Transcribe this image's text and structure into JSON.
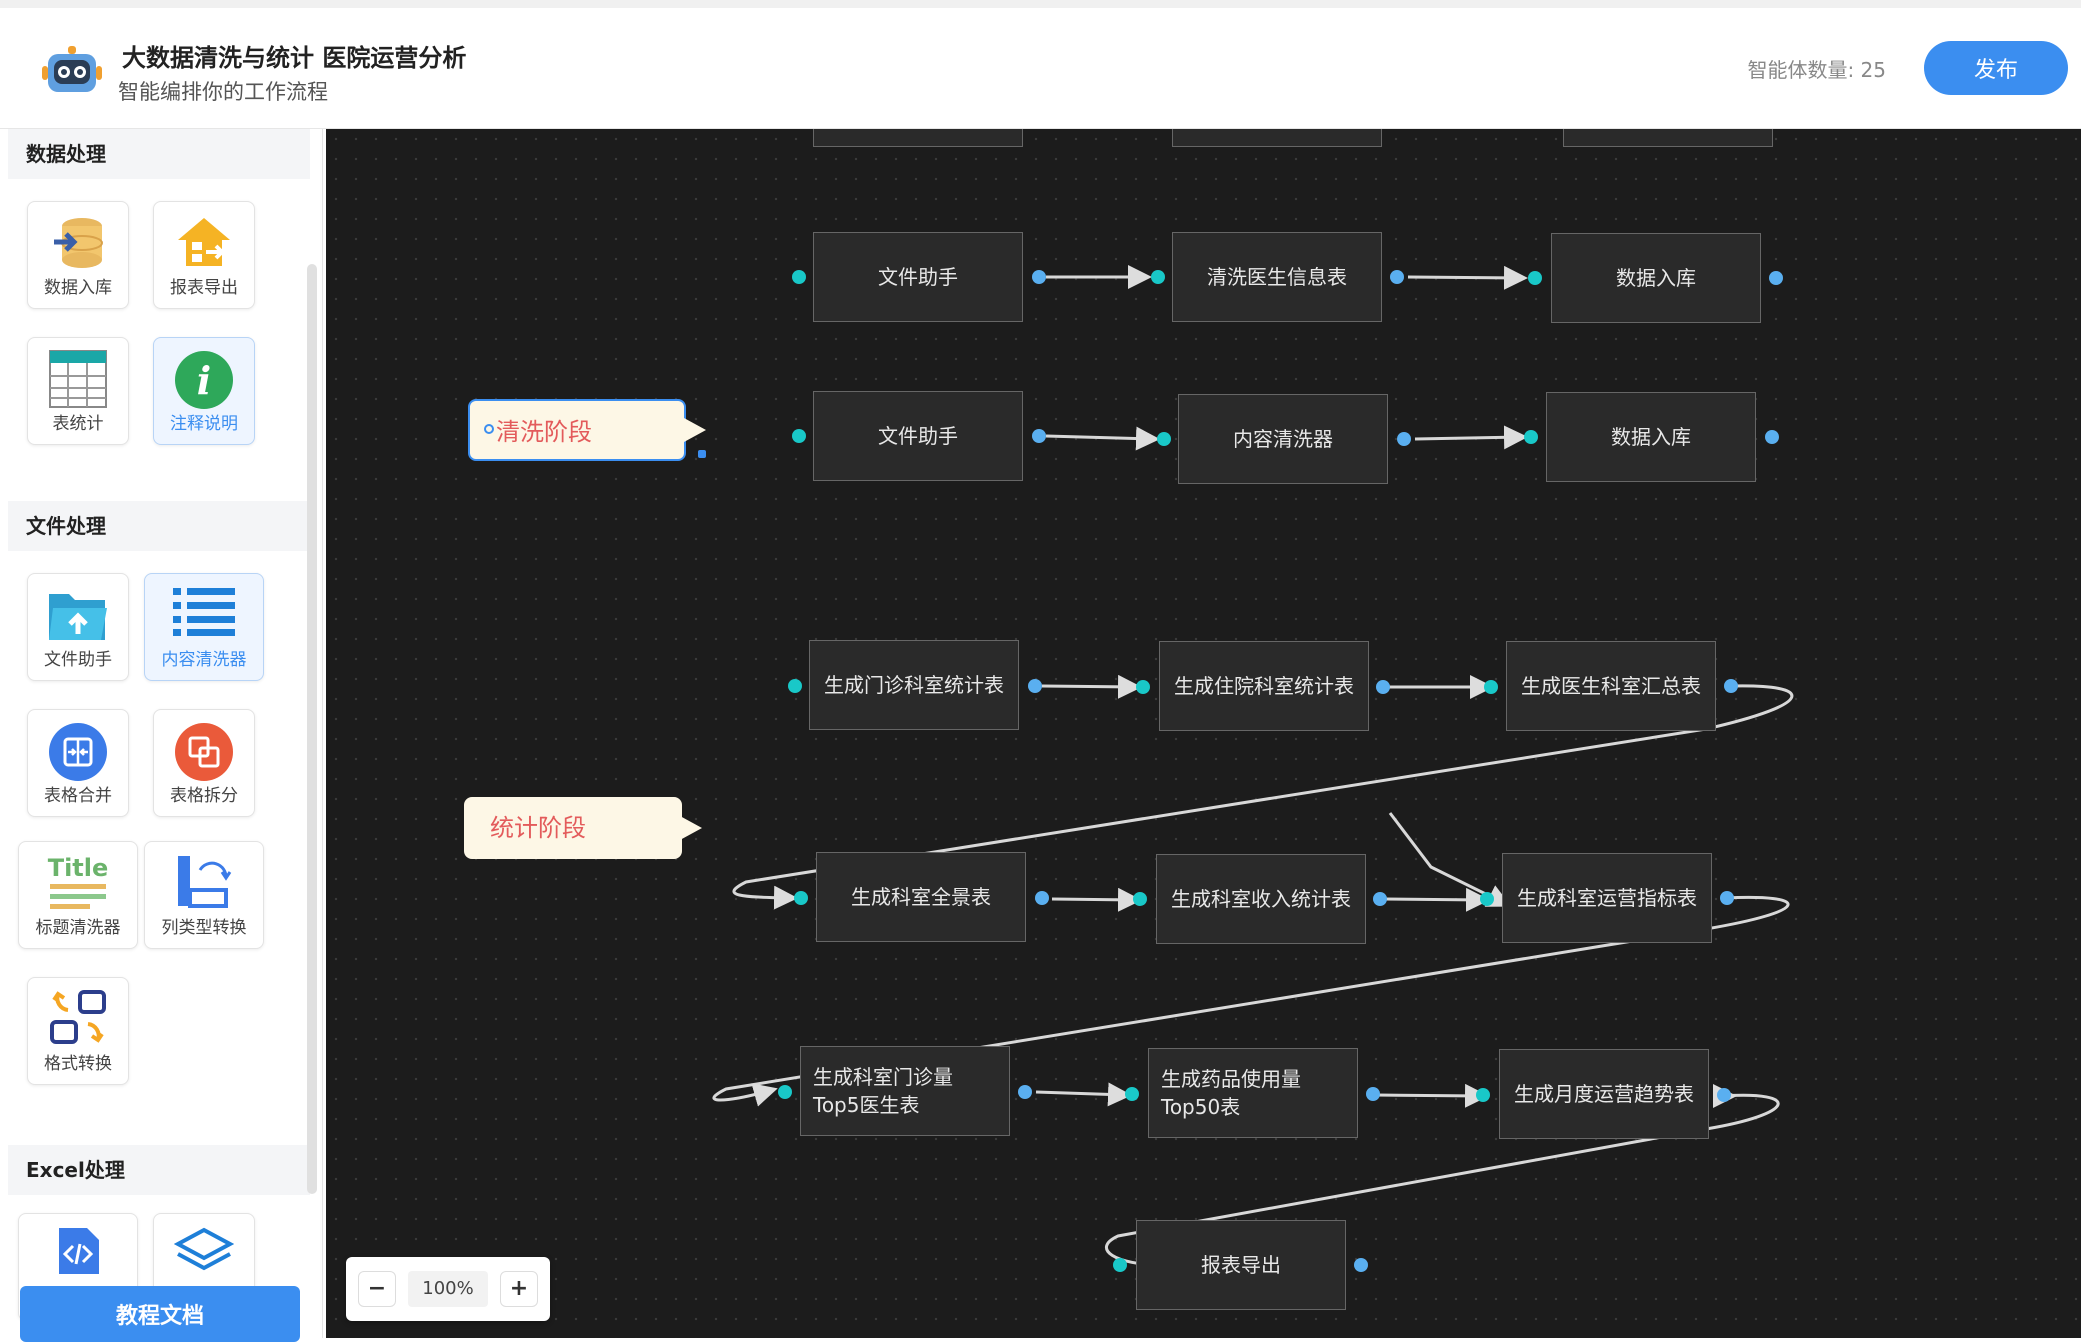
{
  "header": {
    "title": "大数据清洗与统计  医院运营分析",
    "subtitle": "智能编排你的工作流程",
    "agent_count": "智能体数量: 25",
    "publish_label": "发布"
  },
  "sidebar": {
    "sections": {
      "data": "数据处理",
      "file": "文件处理",
      "excel": "Excel处理"
    },
    "tools": {
      "data_import": "数据入库",
      "report_export": "报表导出",
      "table_stats": "表统计",
      "annotation": "注释说明",
      "file_helper": "文件助手",
      "content_cleaner": "内容清洗器",
      "table_merge": "表格合并",
      "table_split": "表格拆分",
      "title_cleaner": "标题清洗器",
      "column_type": "列类型转换",
      "format_convert": "格式转换"
    },
    "icon_text": {
      "title_cleaner": "Title"
    },
    "docs_label": "教程文档"
  },
  "canvas": {
    "notes": {
      "cleaning": "清洗阶段",
      "stats": "统计阶段"
    },
    "nodes": {
      "r1a": "文件助手",
      "r1b": "清洗医生信息表",
      "r1c": "数据入库",
      "r2a": "文件助手",
      "r2b": "内容清洗器",
      "r2c": "数据入库",
      "r3a": "生成门诊科室统计表",
      "r3b": "生成住院科室统计表",
      "r3c": "生成医生科室汇总表",
      "r4a": "生成科室全景表",
      "r4b": "生成科室收入统计表",
      "r4c": "生成科室运营指标表",
      "r5a": "生成科室门诊量Top5医生表",
      "r5b": "生成药品使用量Top50表",
      "r5c": "生成月度运营趋势表",
      "r6a": "报表导出"
    }
  },
  "zoom": {
    "minus": "−",
    "level": "100%",
    "plus": "+"
  },
  "colors": {
    "accent": "#3b8ef0",
    "canvas_bg": "#1c1c1c",
    "port_in": "#19c8c8",
    "port_out": "#5aaff0",
    "note_text": "#e35b5b"
  }
}
